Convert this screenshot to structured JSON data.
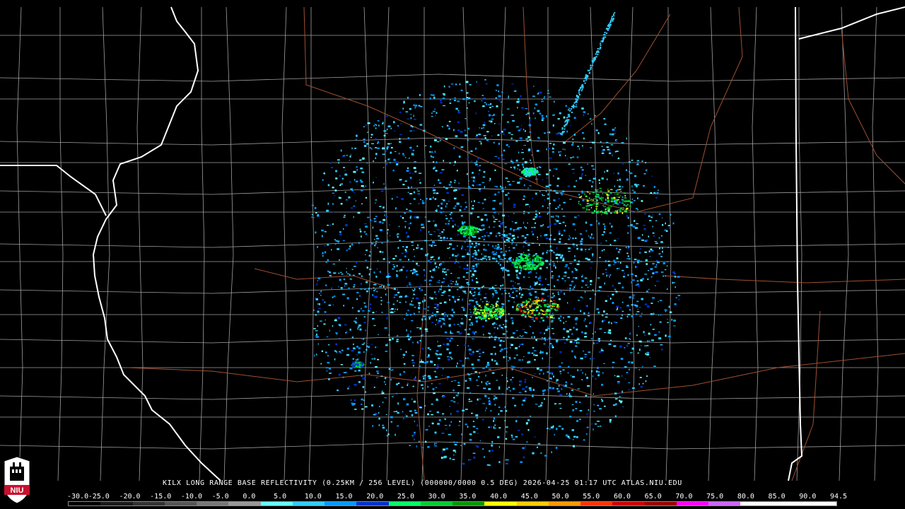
{
  "header": {
    "product_line": "KILX LONG RANGE BASE REFLECTIVITY (0.25KM / 256 LEVEL) (000000/0000 0.5 DEG) 2026-04-25 01:17 UTC  ATLAS.NIU.EDU"
  },
  "legend": {
    "scale_labels": [
      "-30.0",
      "-25.0",
      "-20.0",
      "-15.0",
      "-10.0",
      "-5.0",
      "0.0",
      "5.0",
      "10.0",
      "15.0",
      "20.0",
      "25.0",
      "30.0",
      "35.0",
      "40.0",
      "45.0",
      "50.0",
      "55.0",
      "60.0",
      "65.0",
      "70.0",
      "75.0",
      "80.0",
      "85.0",
      "90.0",
      "94.5"
    ],
    "colors": [
      "#000000",
      "#1a1a1a",
      "#333333",
      "#555555",
      "#777777",
      "#999999",
      "#66ffff",
      "#33ccff",
      "#0099ff",
      "#0033cc",
      "#00ff66",
      "#00cc33",
      "#009900",
      "#ffff00",
      "#ffcc00",
      "#ff9900",
      "#ff3300",
      "#cc0000",
      "#990000",
      "#ff00ff",
      "#cc66ff",
      "#ffffff",
      "#ffffff",
      "#ffffff"
    ]
  },
  "logo": {
    "text": "NIU",
    "color": "#c8102e"
  },
  "map": {
    "state_border_color": "#ffffff",
    "county_line_color": "#a0a0a0",
    "highway_color": "#a05030",
    "radar_center": [
      690,
      385
    ]
  }
}
